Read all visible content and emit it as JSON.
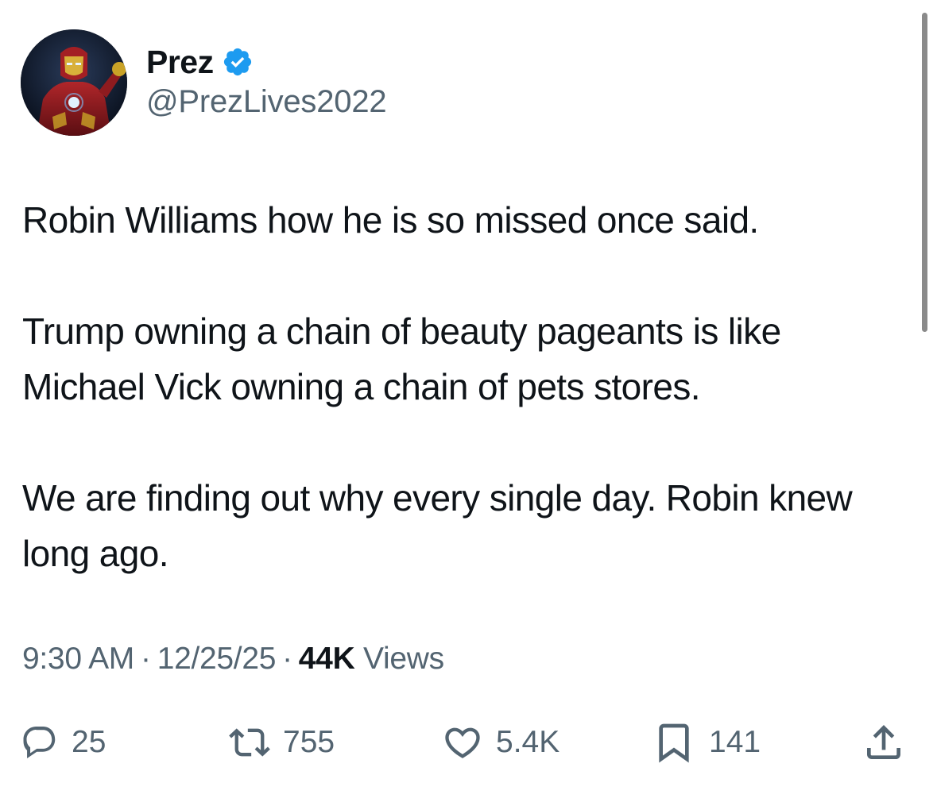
{
  "author": {
    "display_name": "Prez",
    "handle": "@PrezLives2022",
    "verified": true,
    "avatar_icon": "iron-man-avatar-icon"
  },
  "tweet": {
    "paragraphs": [
      "Robin Williams how he is so missed once said.",
      "Trump owning a chain of beauty pageants is like Michael Vick owning a chain of pets stores.",
      "We are finding out why every single day. Robin knew long ago."
    ],
    "time": "9:30 AM",
    "date": "12/25/25",
    "separator": "·",
    "views_count": "44K",
    "views_label": "Views"
  },
  "actions": {
    "replies": "25",
    "reposts": "755",
    "likes": "5.4K",
    "bookmarks": "141",
    "icons": [
      "reply-icon",
      "repost-icon",
      "like-icon",
      "bookmark-icon",
      "share-icon"
    ]
  },
  "colors": {
    "text": "#0f1419",
    "secondary": "#536471",
    "verified_blue": "#1d9bf0"
  }
}
